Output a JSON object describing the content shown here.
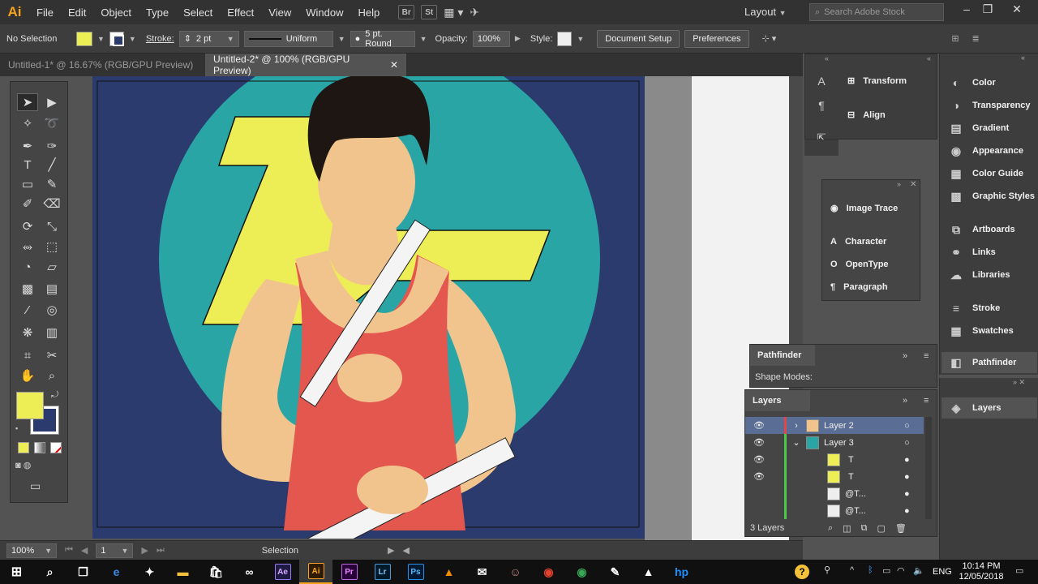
{
  "app": {
    "logo": "Ai",
    "accent": "#f7a21b"
  },
  "menu": [
    "File",
    "Edit",
    "Object",
    "Type",
    "Select",
    "Effect",
    "View",
    "Window",
    "Help"
  ],
  "menubar_icons": [
    "Br",
    "St"
  ],
  "workspace": "Layout",
  "search": {
    "placeholder": "Search Adobe Stock"
  },
  "control": {
    "selection": "No Selection",
    "stroke_label": "Stroke:",
    "stroke_value": "2 pt",
    "profile": "Uniform",
    "brush": "5 pt. Round",
    "opacity_label": "Opacity:",
    "opacity_value": "100%",
    "style_label": "Style:",
    "doc_setup": "Document Setup",
    "preferences": "Preferences",
    "fill_color": "#eded55",
    "stroke_color": "#2b3b6e"
  },
  "tabs": [
    {
      "label": "Untitled-1* @ 16.67% (RGB/GPU Preview)",
      "active": false
    },
    {
      "label": "Untitled-2* @ 100% (RGB/GPU Preview)",
      "active": true
    }
  ],
  "status": {
    "zoom": "100%",
    "artboard": "1",
    "tool": "Selection"
  },
  "panels_mid": {
    "transform": "Transform",
    "align": "Align",
    "image_trace": "Image Trace",
    "character": "Character",
    "opentype": "OpenType",
    "paragraph": "Paragraph"
  },
  "panels_right": [
    "Color",
    "Transparency",
    "Gradient",
    "Appearance",
    "Color Guide",
    "Graphic Styles",
    "Artboards",
    "Links",
    "Libraries",
    "Stroke",
    "Swatches",
    "Pathfinder",
    "Layers"
  ],
  "pathfinder": {
    "title": "Pathfinder",
    "shape_modes": "Shape Modes:"
  },
  "layers": {
    "title": "Layers",
    "count": "3 Layers",
    "rows": [
      {
        "name": "Layer 2",
        "color": "#e04848"
      },
      {
        "name": "Layer 3",
        "color": "#4ac84a"
      },
      {
        "name": "T",
        "color": "#4ac84a"
      },
      {
        "name": "T",
        "color": "#4ac84a"
      },
      {
        "name": "@T...",
        "color": "#4ac84a"
      },
      {
        "name": "@T...",
        "color": "#4ac84a"
      }
    ]
  },
  "taskbar": {
    "time": "10:14 PM",
    "date": "12/05/2018",
    "lang": "ENG",
    "apps": [
      "Ae",
      "Ai",
      "Pr",
      "Lr",
      "Ps"
    ]
  },
  "artwork_colors": {
    "background": "#2b3b6e",
    "circle": "#2aa5a5",
    "letter": "#eded55",
    "skin": "#f1c48e",
    "shirt": "#e3574f",
    "hair": "#1e1613"
  }
}
